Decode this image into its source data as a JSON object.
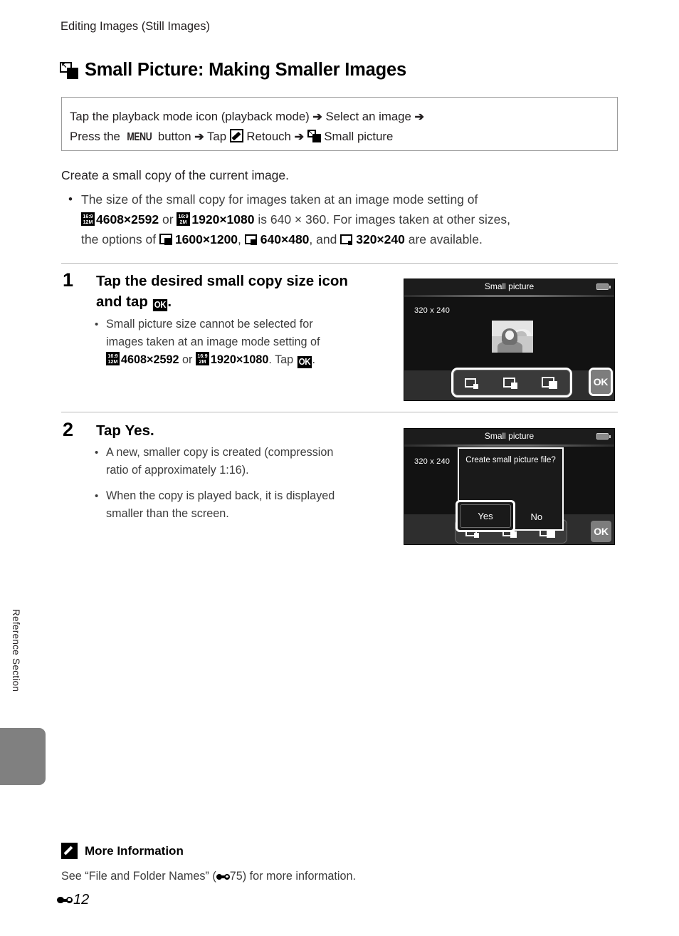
{
  "side_tab": {
    "label": "Reference Section"
  },
  "header": {
    "running_head": "Editing Images (Still Images)",
    "title": "Small Picture: Making Smaller Images",
    "title_icon": "small-picture-icon"
  },
  "procedure_box": {
    "line1_part1": "Tap the playback mode icon (playback mode)",
    "line1_arrow1": "➔",
    "line1_part2": "Select an image",
    "line1_arrow2": "➔",
    "line2_part1": "Press the",
    "line2_menu": "MENU",
    "line2_part2": "button",
    "line2_arrow1": "➔",
    "line2_part3": "Tap",
    "line2_retouch": "Retouch",
    "line2_arrow2": "➔",
    "line2_part4": "Small picture"
  },
  "intro": {
    "lead": "Create a small copy of the current image.",
    "bullet_dot": "•",
    "b1_t1": "The size of the small copy for images taken at an image mode setting of",
    "b1_badge1_top": "16:9",
    "b1_badge1_bottom": "12M",
    "b1_size1": "4608×2592",
    "b1_or": "or",
    "b1_badge2_top": "16:9",
    "b1_badge2_bottom": "2M",
    "b1_size2": "1920×1080",
    "b1_t2": "is 640 × 360. For images taken at other sizes,",
    "b1_t3": "the options of",
    "b1_opt1": "1600×1200",
    "b1_comma1": ",",
    "b1_opt2": "640×480",
    "b1_and": ", and",
    "b1_opt3": "320×240",
    "b1_t4": "are available."
  },
  "steps": [
    {
      "number": "1",
      "heading_part1": "Tap the desired small copy size icon",
      "heading_part2": "and tap",
      "heading_ok": "OK",
      "heading_period": ".",
      "bullets": [
        {
          "dot": "•",
          "l1": "Small picture size cannot be selected for",
          "l2": "images taken at an image mode setting of",
          "badge1_top": "16:9",
          "badge1_bottom": "12M",
          "size1": "4608×2592",
          "or": "or",
          "badge2_top": "16:9",
          "badge2_bottom": "2M",
          "size2": "1920×1080",
          "tail": ". Tap",
          "ok": "OK",
          "period": "."
        }
      ]
    },
    {
      "number": "2",
      "heading_part1": "Tap",
      "heading_bold": "Yes",
      "heading_period": ".",
      "bullets": [
        {
          "dot": "•",
          "l1": "A new, smaller copy is created (compression",
          "l2": "ratio of approximately 1:16)."
        },
        {
          "dot": "•",
          "l1": "When the copy is played back, it is displayed",
          "l2": "smaller than the screen."
        }
      ]
    }
  ],
  "screens": [
    {
      "title": "Small picture",
      "battery_icon": "battery-icon",
      "dims_label": "320 x 240",
      "size_options": [
        {
          "icon": "size-small-icon"
        },
        {
          "icon": "size-medium-icon"
        },
        {
          "icon": "size-large-icon"
        }
      ],
      "ok_label": "OK",
      "thumbnail_alt": "portrait-thumbnail"
    },
    {
      "title": "Small picture",
      "battery_icon": "battery-icon",
      "dims_label": "320 x 240",
      "dialog": {
        "message": "Create small picture file?",
        "yes_label": "Yes",
        "no_label": "No"
      },
      "size_options": [
        {
          "icon": "size-small-icon"
        },
        {
          "icon": "size-medium-icon"
        },
        {
          "icon": "size-large-icon"
        }
      ],
      "ok_label": "OK"
    }
  ],
  "more_information": {
    "icon": "pencil-icon",
    "title": "More Information",
    "text_part1": "See “File and Folder Names” (",
    "ref_icon": "reference-barbell-icon",
    "ref_page": "75",
    "text_part2": ") for more information."
  },
  "folio": {
    "icon": "reference-barbell-icon",
    "page": "12"
  }
}
